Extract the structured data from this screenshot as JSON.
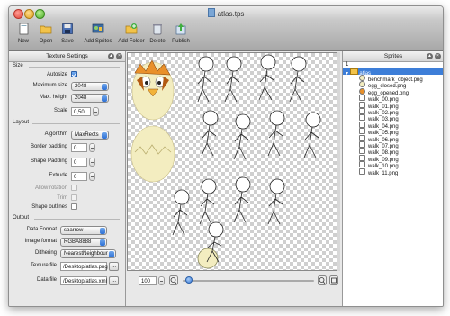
{
  "window": {
    "title": "atlas.tps"
  },
  "toolbar": {
    "items": [
      {
        "label": "New",
        "icon": "new-doc-icon"
      },
      {
        "label": "Open",
        "icon": "folder-icon"
      },
      {
        "label": "Save",
        "icon": "floppy-icon"
      },
      {
        "label": "Add Sprites",
        "icon": "add-sprites-icon"
      },
      {
        "label": "Add Folder",
        "icon": "add-folder-icon"
      },
      {
        "label": "Delete",
        "icon": "trash-icon"
      },
      {
        "label": "Publish",
        "icon": "publish-icon"
      }
    ]
  },
  "texture_settings": {
    "title": "Texture Settings",
    "size": {
      "heading": "Size",
      "autosize_label": "Autosize",
      "max_width_label": "Maximum size",
      "max_width_value": "2048",
      "max_height_label": "Max. height",
      "max_height_value": "2048",
      "scale_label": "Scale",
      "scale_value": "0,50"
    },
    "layout": {
      "heading": "Layout",
      "algorithm_label": "Algorithm",
      "algorithm_value": "MaxRects",
      "border_padding_label": "Border padding",
      "border_padding_value": "0",
      "shape_padding_label": "Shape Padding",
      "shape_padding_value": "0",
      "extrude_label": "Extrude",
      "extrude_value": "0",
      "allow_rotation_label": "Allow rotation",
      "trim_label": "Trim",
      "shape_outlines_label": "Shape outlines"
    },
    "output": {
      "heading": "Output",
      "data_format_label": "Data Format",
      "data_format_value": "sparrow",
      "image_format_label": "Image format",
      "image_format_value": "RGBA8888",
      "dithering_label": "Dithering",
      "dithering_value": "NearestNeighbour",
      "texture_file_label": "Texture file",
      "texture_file_value": "/Desktop/atlas.png",
      "data_file_label": "Data file",
      "data_file_value": "/Desktop/atlas.xml",
      "browse_label": "..."
    }
  },
  "sprites": {
    "title": "Sprites",
    "count": "1",
    "folder": "atlas",
    "items": [
      "benchmark_object.png",
      "egg_closed.png",
      "egg_opened.png",
      "walk_00.png",
      "walk_01.png",
      "walk_02.png",
      "walk_03.png",
      "walk_04.png",
      "walk_05.png",
      "walk_06.png",
      "walk_07.png",
      "walk_08.png",
      "walk_09.png",
      "walk_10.png",
      "walk_11.png"
    ]
  },
  "zoom": {
    "value": "100"
  },
  "colors": {
    "selection": "#3d7ed8",
    "egg": "#f3edc0",
    "bird": "#e9902a"
  }
}
